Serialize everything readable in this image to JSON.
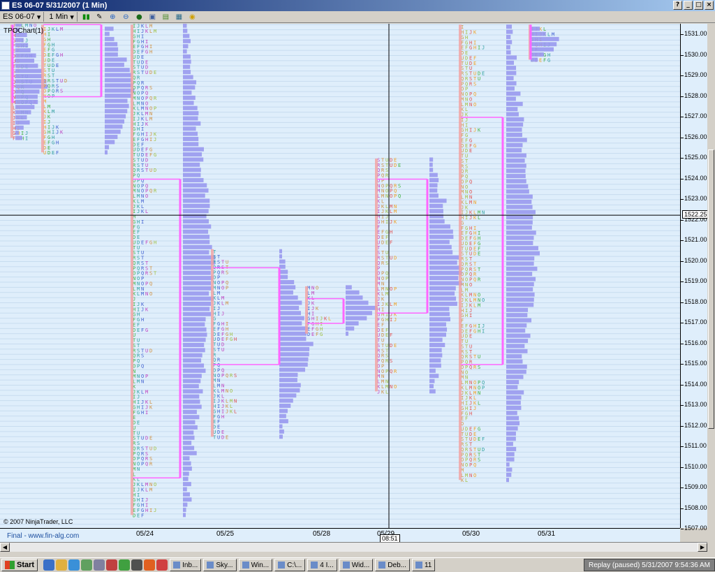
{
  "window": {
    "title": "ES 06-07  5/31/2007  (1 Min)",
    "buttons": [
      "?",
      "_",
      "□",
      "×"
    ]
  },
  "toolbar": {
    "instrument": "ES 06-07",
    "interval": "1 Min",
    "icons": [
      "bar-style-icon",
      "draw-pencil-icon",
      "zoom-in-icon",
      "zoom-out-icon",
      "globe-icon",
      "properties-icon",
      "data-box-icon",
      "chart-trader-icon",
      "alert-icon"
    ]
  },
  "chart": {
    "label": "TPOChart(1)",
    "copyright": "© 2007 NinjaTrader, LLC",
    "footer_link": "Final - www.fin-alg.com",
    "crosshair_price": "1522.25",
    "crosshair_time": "08:51",
    "price_ticks": [
      "1531.00",
      "1530.00",
      "1529.00",
      "1528.00",
      "1527.00",
      "1526.00",
      "1525.00",
      "1524.00",
      "1523.00",
      "1522.00",
      "1521.00",
      "1520.00",
      "1519.00",
      "1518.00",
      "1517.00",
      "1516.00",
      "1515.00",
      "1514.00",
      "1513.00",
      "1512.00",
      "1511.00",
      "1510.00",
      "1509.00",
      "1508.00",
      "1507.00"
    ],
    "dates": [
      "05/24",
      "05/25",
      "05/28",
      "05/29",
      "05/30",
      "05/31"
    ],
    "colors": {
      "background": "#dfeefb",
      "profile_bar": "#9999ee",
      "value_area_line": "#ff66ff",
      "crosshair": "#000000"
    }
  },
  "taskbar": {
    "start": "Start",
    "tasks": [
      "Inb...",
      "Sky...",
      "Win...",
      "C:\\...",
      "4 I...",
      "Wid...",
      "Deb...",
      "11"
    ],
    "tray": "Replay (paused)  5/31/2007  9:54:36 AM"
  }
}
